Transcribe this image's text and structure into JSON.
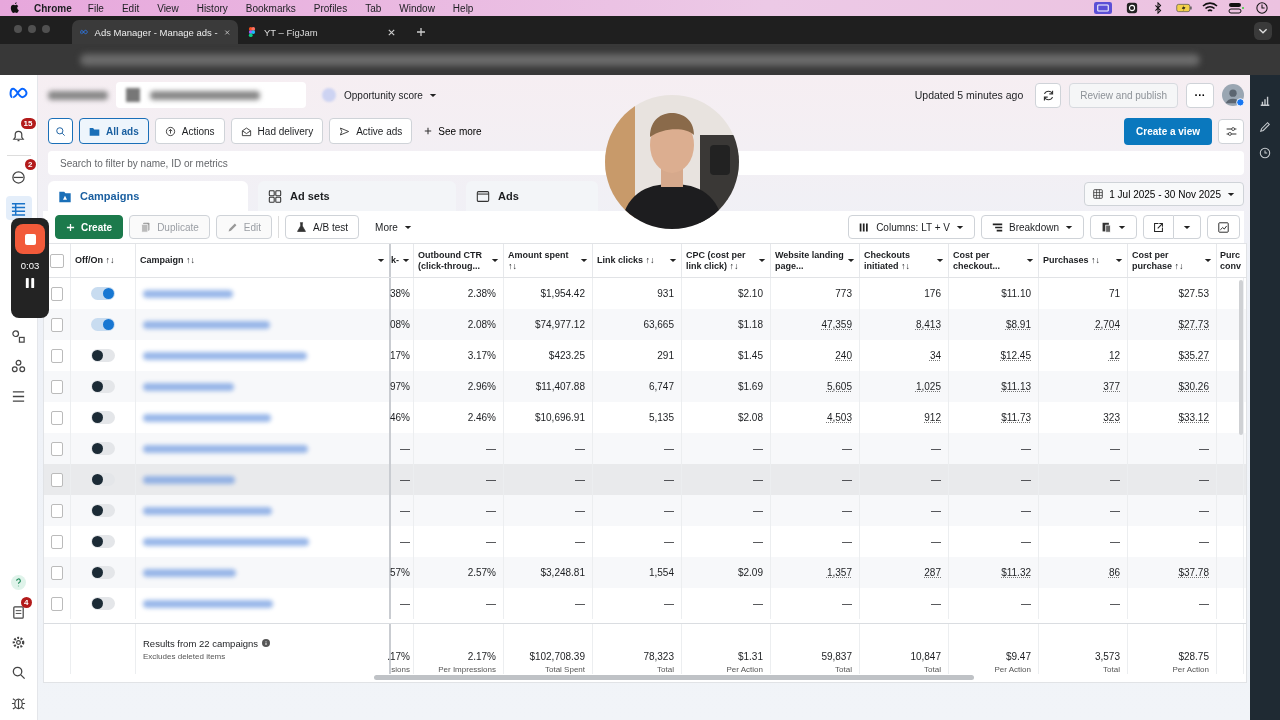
{
  "menubar": {
    "app": "Chrome",
    "items": [
      "File",
      "Edit",
      "View",
      "History",
      "Bookmarks",
      "Profiles",
      "Tab",
      "Window",
      "Help"
    ]
  },
  "browser_tabs": [
    {
      "title": "Ads Manager - Manage ads -",
      "selected": true
    },
    {
      "title": "YT – FigJam",
      "selected": false
    }
  ],
  "left_rail": {
    "badges": [
      {
        "count": "15"
      },
      {
        "count": "2"
      },
      {
        "count": "4"
      }
    ]
  },
  "header": {
    "opportunity": "Opportunity score",
    "updated": "Updated 5 minutes ago",
    "publish": {
      "label": "Review and publish",
      "disabled": true
    },
    "more": "···"
  },
  "filters": [
    {
      "label": "All ads",
      "selected": true
    },
    {
      "label": "Actions",
      "selected": false
    },
    {
      "label": "Had delivery",
      "selected": false
    },
    {
      "label": "Active ads",
      "selected": false
    }
  ],
  "see_more": "See more",
  "create_view": "Create a view",
  "search": {
    "placeholder": "Search to filter by name, ID or metrics"
  },
  "level_tabs": [
    {
      "label": "Campaigns",
      "selected": true
    },
    {
      "label": "Ad sets",
      "selected": false
    },
    {
      "label": "Ads",
      "selected": false
    }
  ],
  "date_range": "1 Jul 2025 - 30 Nov 2025",
  "toolbar": {
    "create": "Create",
    "duplicate": {
      "label": "Duplicate",
      "disabled": true
    },
    "edit": {
      "label": "Edit",
      "disabled": true
    },
    "ab_test": "A/B test",
    "more": "More",
    "columns": "Columns: LT + V",
    "breakdown": "Breakdown"
  },
  "recorder": {
    "time": "0:03"
  },
  "table": {
    "all_checked": false,
    "toggle_header": "Off/On ↑↓",
    "name_header": "Campaign ↑↓",
    "columns": [
      {
        "label": "k-"
      },
      {
        "label": "Outbound CTR (click-throug..."
      },
      {
        "label": "Amount spent ↑↓"
      },
      {
        "label": "Link clicks ↑↓"
      },
      {
        "label": "CPC (cost per link click) ↑↓"
      },
      {
        "label": "Website landing page..."
      },
      {
        "label": "Checkouts initiated ↑↓"
      },
      {
        "label": "Cost per checkout..."
      },
      {
        "label": "Purchases ↑↓"
      },
      {
        "label": "Cost per purchase ↑↓"
      },
      {
        "label": "Purc conv"
      }
    ],
    "rows": [
      {
        "checked": false,
        "on": true,
        "underlined": false,
        "highlighted": false,
        "cells": [
          "38%",
          "2.38%",
          "$1,954.42",
          "931",
          "$2.10",
          "773",
          "176",
          "$11.10",
          "71",
          "$27.53"
        ]
      },
      {
        "checked": false,
        "on": true,
        "underlined": true,
        "highlighted": false,
        "cells": [
          "08%",
          "2.08%",
          "$74,977.12",
          "63,665",
          "$1.18",
          "47,359",
          "8,413",
          "$8.91",
          "2,704",
          "$27.73"
        ]
      },
      {
        "checked": false,
        "on": false,
        "underlined": true,
        "highlighted": false,
        "cells": [
          "17%",
          "3.17%",
          "$423.25",
          "291",
          "$1.45",
          "240",
          "34",
          "$12.45",
          "12",
          "$35.27"
        ]
      },
      {
        "checked": false,
        "on": false,
        "underlined": true,
        "highlighted": false,
        "cells": [
          "97%",
          "2.96%",
          "$11,407.88",
          "6,747",
          "$1.69",
          "5,605",
          "1,025",
          "$11.13",
          "377",
          "$30.26"
        ]
      },
      {
        "checked": false,
        "on": false,
        "underlined": true,
        "highlighted": false,
        "cells": [
          "46%",
          "2.46%",
          "$10,696.91",
          "5,135",
          "$2.08",
          "4,503",
          "912",
          "$11.73",
          "323",
          "$33.12"
        ]
      },
      {
        "checked": false,
        "on": false,
        "underlined": false,
        "highlighted": false,
        "cells": [
          "—",
          "—",
          "—",
          "—",
          "—",
          "—",
          "—",
          "—",
          "—",
          "—"
        ]
      },
      {
        "checked": false,
        "on": false,
        "underlined": false,
        "highlighted": true,
        "cells": [
          "—",
          "—",
          "—",
          "—",
          "—",
          "—",
          "—",
          "—",
          "—",
          "—"
        ]
      },
      {
        "checked": false,
        "on": false,
        "underlined": false,
        "highlighted": false,
        "cells": [
          "—",
          "—",
          "—",
          "—",
          "—",
          "—",
          "—",
          "—",
          "—",
          "—"
        ]
      },
      {
        "checked": false,
        "on": false,
        "underlined": false,
        "highlighted": false,
        "cells": [
          "—",
          "—",
          "—",
          "—",
          "—",
          "—",
          "—",
          "—",
          "—",
          "—"
        ]
      },
      {
        "checked": false,
        "on": false,
        "underlined": true,
        "highlighted": false,
        "cells": [
          "57%",
          "2.57%",
          "$3,248.81",
          "1,554",
          "$2.09",
          "1,357",
          "287",
          "$11.32",
          "86",
          "$37.78"
        ]
      },
      {
        "checked": false,
        "on": false,
        "underlined": false,
        "highlighted": false,
        "cells": [
          "—",
          "—",
          "—",
          "—",
          "—",
          "—",
          "—",
          "—",
          "—",
          "—"
        ]
      }
    ],
    "footer": {
      "title": "Results from 22 campaigns",
      "note": "Excludes deleted items",
      "cells": [
        {
          "value": ".17%",
          "sub": "sions"
        },
        {
          "value": "2.17%",
          "sub": "Per Impressions"
        },
        {
          "value": "$102,708.39",
          "sub": "Total Spent"
        },
        {
          "value": "78,323",
          "sub": "Total"
        },
        {
          "value": "$1.31",
          "sub": "Per Action"
        },
        {
          "value": "59,837",
          "sub": "Total"
        },
        {
          "value": "10,847",
          "sub": "Total"
        },
        {
          "value": "$9.47",
          "sub": "Per Action"
        },
        {
          "value": "3,573",
          "sub": "Total"
        },
        {
          "value": "$28.75",
          "sub": "Per Action"
        }
      ]
    }
  }
}
